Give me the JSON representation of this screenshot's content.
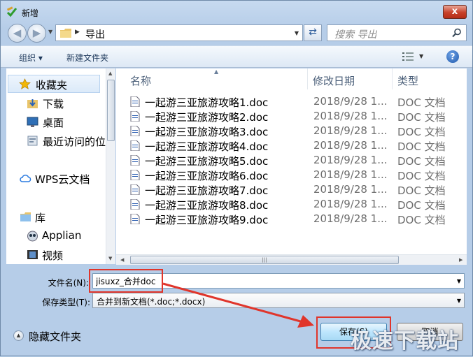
{
  "window": {
    "title": "新增",
    "close_label": "x"
  },
  "nav": {
    "address_path": "导出",
    "search_placeholder": "搜索 导出"
  },
  "toolbar": {
    "organize_label": "组织 ▾",
    "new_folder_label": "新建文件夹",
    "help_label": "?"
  },
  "sidebar": {
    "items": [
      {
        "label": "收藏夹",
        "icon": "star-icon"
      },
      {
        "label": "下载",
        "icon": "download-folder-icon"
      },
      {
        "label": "桌面",
        "icon": "desktop-icon"
      },
      {
        "label": "最近访问的位置",
        "icon": "recent-places-icon"
      },
      {
        "label": "WPS云文档",
        "icon": "cloud-icon"
      },
      {
        "label": "库",
        "icon": "library-icon"
      },
      {
        "label": "Applian",
        "icon": "applian-icon"
      },
      {
        "label": "视频",
        "icon": "video-icon"
      }
    ]
  },
  "filelist": {
    "columns": {
      "name": "名称",
      "date": "修改日期",
      "type": "类型"
    },
    "rows": [
      {
        "name": "一起游三亚旅游攻略1.doc",
        "date": "2018/9/28 1...",
        "type": "DOC 文档"
      },
      {
        "name": "一起游三亚旅游攻略2.doc",
        "date": "2018/9/28 1...",
        "type": "DOC 文档"
      },
      {
        "name": "一起游三亚旅游攻略3.doc",
        "date": "2018/9/28 1...",
        "type": "DOC 文档"
      },
      {
        "name": "一起游三亚旅游攻略4.doc",
        "date": "2018/9/28 1...",
        "type": "DOC 文档"
      },
      {
        "name": "一起游三亚旅游攻略5.doc",
        "date": "2018/9/28 1...",
        "type": "DOC 文档"
      },
      {
        "name": "一起游三亚旅游攻略6.doc",
        "date": "2018/9/28 1...",
        "type": "DOC 文档"
      },
      {
        "name": "一起游三亚旅游攻略7.doc",
        "date": "2018/9/28 1...",
        "type": "DOC 文档"
      },
      {
        "name": "一起游三亚旅游攻略8.doc",
        "date": "2018/9/28 1...",
        "type": "DOC 文档"
      },
      {
        "name": "一起游三亚旅游攻略9.doc",
        "date": "2018/9/28 1...",
        "type": "DOC 文档"
      }
    ]
  },
  "form": {
    "filename_label": "文件名(N):",
    "filename_value": "jisuxz_合并doc",
    "filetype_label": "保存类型(T):",
    "filetype_value": "合并到新文档(*.doc;*.docx)"
  },
  "footer": {
    "hide_folders_label": "隐藏文件夹",
    "save_label": "保存(S)",
    "cancel_label": "取消"
  },
  "watermark": "极速下载站",
  "colors": {
    "highlight_red": "#e0352b",
    "window_bg": "#b6cde8"
  }
}
